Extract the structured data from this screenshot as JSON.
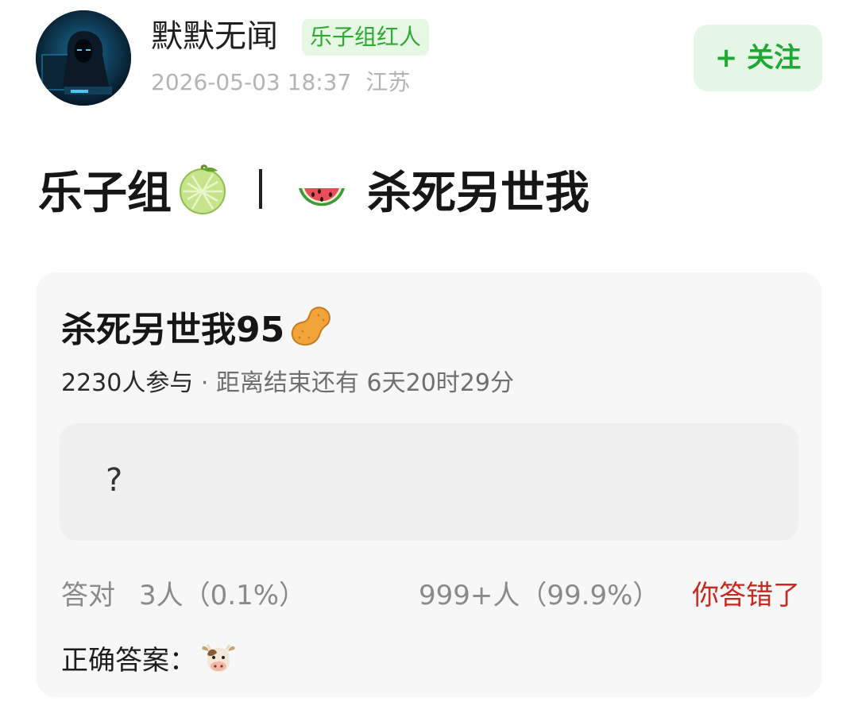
{
  "author": {
    "name": "默默无闻",
    "badge": "乐子组红人",
    "date": "2026-05-03 18:37",
    "location": "江苏",
    "avatar_icon": "hooded-hacker-avatar"
  },
  "follow_button": {
    "label": "+ 关注",
    "color": "#1fa834"
  },
  "post": {
    "title_left": "乐子组",
    "title_right": "杀死另世我",
    "title_left_icon": "melon-icon",
    "title_right_icon": "watermelon-icon"
  },
  "quiz": {
    "title": "杀死另世我95",
    "title_icon": "peanut-icon",
    "participants": "2230人参与",
    "separator": "·",
    "countdown": "距离结束还有 6天20时29分",
    "question": "?",
    "correct_label": "答对",
    "correct_count": "3人（0.1%）",
    "wrong_count": "999+人（99.9%）",
    "wrong_verdict": "你答错了",
    "answer_label": "正确答案：",
    "answer_icon": "cow-face-icon",
    "verdict_color": "#c8281e"
  }
}
